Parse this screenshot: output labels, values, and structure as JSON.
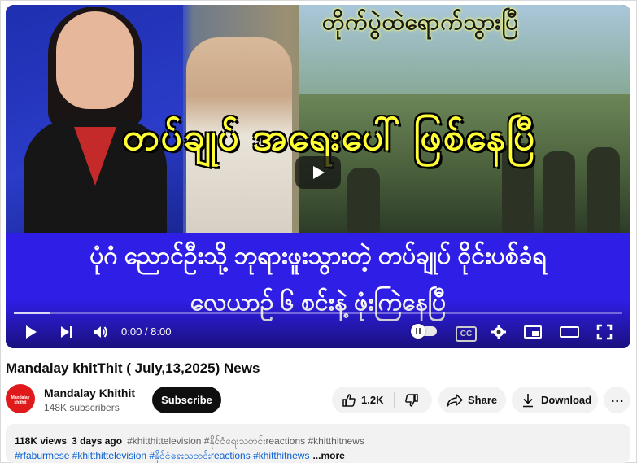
{
  "video": {
    "overlay_top": "တိုက်ပွဲထဲရောက်သွားပြီ",
    "overlay_main": "တပ်ချုပ် အရေးပေါ် ဖြစ်နေပြီ",
    "caption_line1": "ပုံဂံ ညောင်ဦးသို့ ဘုရားဖူးသွားတဲ့ တပ်ချုပ် ဝိုင်းပစ်ခံရ",
    "caption_line2": "လေယာဉ် ၆ စင်းနဲ့ ဖုံးကြဲနေပြီ",
    "time_display": "0:00 / 8:00",
    "progress_fraction": 0.06,
    "cc_label": "CC"
  },
  "title": "Mandalay khitThit ( July,13,2025) News",
  "channel": {
    "name": "Mandalay Khithit",
    "subscribers": "148K subscribers",
    "avatar_text": "Mandalay khithit",
    "subscribe_label": "Subscribe"
  },
  "actions": {
    "like_count": "1.2K",
    "share_label": "Share",
    "download_label": "Download",
    "more_label": "..."
  },
  "description": {
    "views": "118K views",
    "age": "3 days ago",
    "line1_tags": "#khitthittelevision #နိုင်ငံရေးသတင်းreactions #khitthitnews",
    "line2_tags": "#rfaburmese #khitthittelevision #နိုင်ငံရေးသတင်းreactions #khitthitnews",
    "more_label": "...more"
  },
  "colors": {
    "caption_band": "#2f1ee6",
    "headline_yellow": "#ffff33",
    "subscribe_bg": "#0f0f0f",
    "link_blue": "#065fd4",
    "avatar_red": "#e01a1a"
  }
}
